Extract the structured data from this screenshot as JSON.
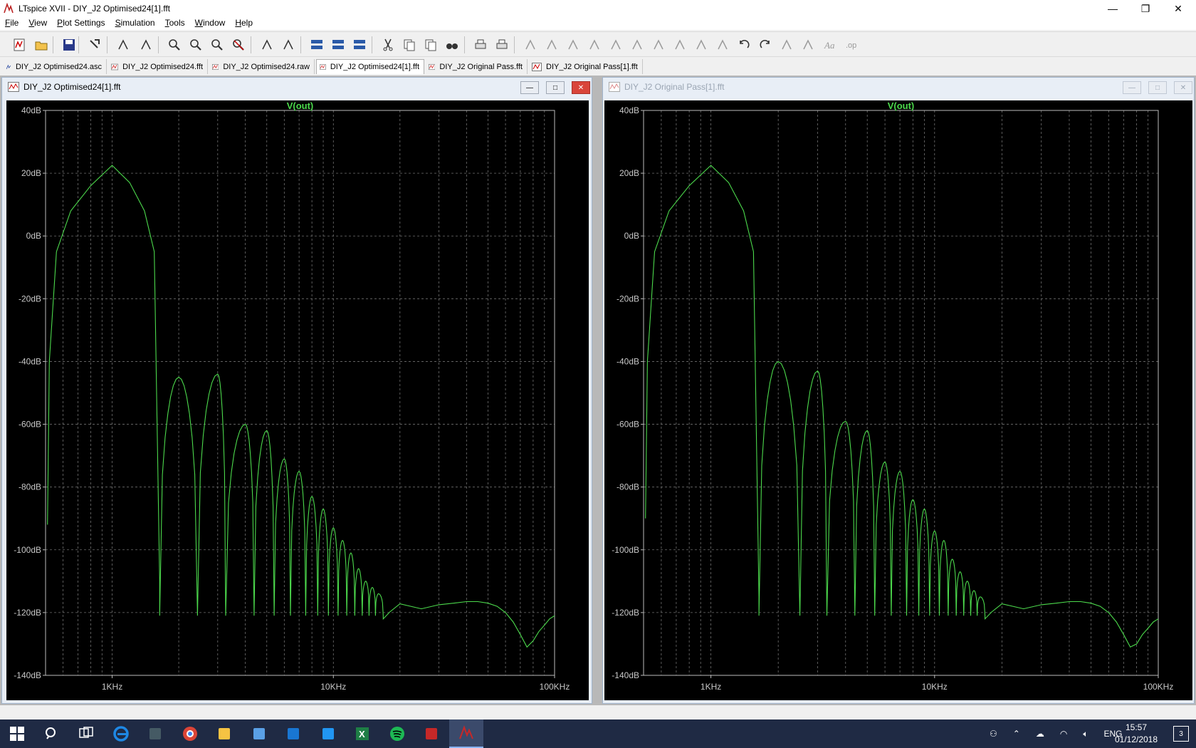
{
  "window": {
    "title": "LTspice XVII - DIY_J2 Optimised24[1].fft",
    "minimize_glyph": "—",
    "restore_glyph": "❐",
    "close_glyph": "✕"
  },
  "menu": {
    "items": [
      {
        "label": "File",
        "ul": "F",
        "rest": "ile"
      },
      {
        "label": "View",
        "ul": "V",
        "rest": "iew"
      },
      {
        "label": "Plot Settings",
        "ul": "P",
        "rest": "lot Settings"
      },
      {
        "label": "Simulation",
        "ul": "S",
        "rest": "imulation"
      },
      {
        "label": "Tools",
        "ul": "T",
        "rest": "ools"
      },
      {
        "label": "Window",
        "ul": "W",
        "rest": "indow"
      },
      {
        "label": "Help",
        "ul": "H",
        "rest": "elp"
      }
    ]
  },
  "toolbar": {
    "icons": [
      "new-schematic-icon",
      "open-icon",
      "save-icon",
      "control-panel-icon",
      "run-icon",
      "halt-icon",
      "zoom-in-icon",
      "zoom-fit-icon",
      "zoom-out-icon",
      "zoom-cancel-icon",
      "autorange-icon",
      "mark-unused-icon",
      "tile-icon",
      "cascade-icon",
      "arrange-icons-icon",
      "cut-icon",
      "copy-icon",
      "paste-icon",
      "find-icon",
      "print-preview-icon",
      "print-icon",
      "draw-wire-icon",
      "ground-icon",
      "label-net-icon",
      "resistor-icon",
      "capacitor-icon",
      "inductor-icon",
      "diode-icon",
      "component-icon",
      "move-icon",
      "drag-icon",
      "undo-icon",
      "redo-icon",
      "rotate-icon",
      "mirror-icon",
      "text-icon",
      "spice-directive-icon"
    ]
  },
  "tabs": [
    {
      "label": "DIY_J2 Optimised24.asc",
      "kind": "schematic"
    },
    {
      "label": "DIY_J2 Optimised24.fft",
      "kind": "waveform"
    },
    {
      "label": "DIY_J2 Optimised24.raw",
      "kind": "waveform"
    },
    {
      "label": "DIY_J2 Optimised24[1].fft",
      "kind": "waveform",
      "active": true
    },
    {
      "label": "DIY_J2 Original Pass.fft",
      "kind": "waveform"
    },
    {
      "label": "DIY_J2 Original Pass[1].fft",
      "kind": "waveform"
    }
  ],
  "panes": [
    {
      "title": "DIY_J2 Optimised24[1].fft",
      "active": true
    },
    {
      "title": "DIY_J2 Original Pass[1].fft",
      "active": false
    }
  ],
  "chart_data": [
    {
      "type": "line",
      "title": "V(out)",
      "xscale": "log",
      "xlim": [
        500,
        100000
      ],
      "ylim": [
        -140,
        40
      ],
      "x_ticks": [
        "1KHz",
        "10KHz",
        "100KHz"
      ],
      "y_ticks": [
        "40dB",
        "20dB",
        "0dB",
        "-20dB",
        "-40dB",
        "-60dB",
        "-80dB",
        "-100dB",
        "-120dB",
        "-140dB"
      ],
      "grid": true,
      "line_color": "#4cd94c",
      "series": [
        {
          "name": "V(out)",
          "fundamental": {
            "x": [
              510,
              520,
              560,
              650,
              800,
              1000,
              1200,
              1400,
              1550,
              1640
            ],
            "y": [
              -92,
              -40,
              -5,
              8,
              16,
              22.5,
              17,
              8,
              -5,
              -110
            ]
          },
          "lobes": [
            {
              "x0": 1640,
              "peak": 2000,
              "x1": 2430,
              "y": -45
            },
            {
              "x0": 2430,
              "peak": 3000,
              "x1": 3260,
              "y": -44
            },
            {
              "x0": 3260,
              "peak": 4000,
              "x1": 4380,
              "y": -60
            },
            {
              "x0": 4380,
              "peak": 5000,
              "x1": 5400,
              "y": -62
            },
            {
              "x0": 5400,
              "peak": 6000,
              "x1": 6400,
              "y": -71
            },
            {
              "x0": 6400,
              "peak": 7000,
              "x1": 7500,
              "y": -75
            },
            {
              "x0": 7500,
              "peak": 8000,
              "x1": 8500,
              "y": -83
            },
            {
              "x0": 8500,
              "peak": 9000,
              "x1": 9500,
              "y": -87
            },
            {
              "x0": 9500,
              "peak": 10000,
              "x1": 10500,
              "y": -93
            },
            {
              "x0": 10500,
              "peak": 11000,
              "x1": 11500,
              "y": -97
            },
            {
              "x0": 11500,
              "peak": 12000,
              "x1": 12500,
              "y": -101
            },
            {
              "x0": 12500,
              "peak": 13000,
              "x1": 13500,
              "y": -106
            },
            {
              "x0": 13500,
              "peak": 14000,
              "x1": 14500,
              "y": -110
            },
            {
              "x0": 14500,
              "peak": 15000,
              "x1": 15500,
              "y": -112
            },
            {
              "x0": 15500,
              "peak": 16000,
              "x1": 16800,
              "y": -114
            }
          ],
          "tail": {
            "x": [
              16800,
              18000,
              20000,
              25000,
              30000,
              35000,
              40000,
              45000,
              50000,
              55000,
              60000,
              65000,
              70000,
              75000,
              80000,
              85000,
              90000,
              95000,
              100000
            ],
            "y": [
              -122,
              -119,
              -118,
              -118,
              -117.5,
              -117,
              -116.5,
              -116.5,
              -117,
              -118,
              -120,
              -123,
              -127,
              -131,
              -129,
              -126,
              -124,
              -122,
              -121
            ]
          },
          "floor": -121
        }
      ]
    },
    {
      "type": "line",
      "title": "V(out)",
      "xscale": "log",
      "xlim": [
        500,
        100000
      ],
      "ylim": [
        -140,
        40
      ],
      "x_ticks": [
        "1KHz",
        "10KHz",
        "100KHz"
      ],
      "y_ticks": [
        "40dB",
        "20dB",
        "0dB",
        "-20dB",
        "-40dB",
        "-60dB",
        "-80dB",
        "-100dB",
        "-120dB",
        "-140dB"
      ],
      "grid": true,
      "line_color": "#4cd94c",
      "series": [
        {
          "name": "V(out)",
          "fundamental": {
            "x": [
              510,
              520,
              560,
              650,
              800,
              1000,
              1200,
              1400,
              1550,
              1640
            ],
            "y": [
              -90,
              -40,
              -5,
              8,
              16,
              22.5,
              17,
              8,
              -5,
              -115
            ]
          },
          "lobes": [
            {
              "x0": 1640,
              "peak": 2000,
              "x1": 2500,
              "y": -40
            },
            {
              "x0": 2500,
              "peak": 3000,
              "x1": 3300,
              "y": -43
            },
            {
              "x0": 3300,
              "peak": 4000,
              "x1": 4400,
              "y": -59
            },
            {
              "x0": 4400,
              "peak": 5000,
              "x1": 5400,
              "y": -62
            },
            {
              "x0": 5400,
              "peak": 6000,
              "x1": 6400,
              "y": -72
            },
            {
              "x0": 6400,
              "peak": 7000,
              "x1": 7500,
              "y": -75
            },
            {
              "x0": 7500,
              "peak": 8000,
              "x1": 8500,
              "y": -84
            },
            {
              "x0": 8500,
              "peak": 9000,
              "x1": 9500,
              "y": -87
            },
            {
              "x0": 9500,
              "peak": 10000,
              "x1": 10500,
              "y": -94
            },
            {
              "x0": 10500,
              "peak": 11000,
              "x1": 11500,
              "y": -97
            },
            {
              "x0": 11500,
              "peak": 12000,
              "x1": 12500,
              "y": -103
            },
            {
              "x0": 12500,
              "peak": 13000,
              "x1": 13500,
              "y": -107
            },
            {
              "x0": 13500,
              "peak": 14000,
              "x1": 14500,
              "y": -110
            },
            {
              "x0": 14500,
              "peak": 15000,
              "x1": 15500,
              "y": -113
            },
            {
              "x0": 15500,
              "peak": 16000,
              "x1": 16800,
              "y": -115
            }
          ],
          "tail": {
            "x": [
              16800,
              18000,
              20000,
              25000,
              30000,
              35000,
              40000,
              45000,
              50000,
              55000,
              60000,
              65000,
              70000,
              75000,
              80000,
              85000,
              90000,
              95000,
              100000
            ],
            "y": [
              -122,
              -119,
              -118,
              -118,
              -117.5,
              -117,
              -116.5,
              -116.5,
              -117,
              -118,
              -120,
              -123,
              -127,
              -131,
              -130,
              -127,
              -125,
              -123,
              -122
            ]
          },
          "floor": -121
        }
      ]
    }
  ],
  "taskbar": {
    "apps": [
      "start-icon",
      "search-icon",
      "task-view-icon",
      "edge-icon",
      "calculator-icon",
      "chrome-icon",
      "file-explorer-icon",
      "remote-desktop-icon",
      "store-icon",
      "settings-app-icon",
      "excel-icon",
      "spotify-icon",
      "app-icon",
      "ltspice-icon"
    ],
    "lang": "ENG",
    "time": "15:57",
    "date": "01/12/2018",
    "notifications": "3"
  }
}
